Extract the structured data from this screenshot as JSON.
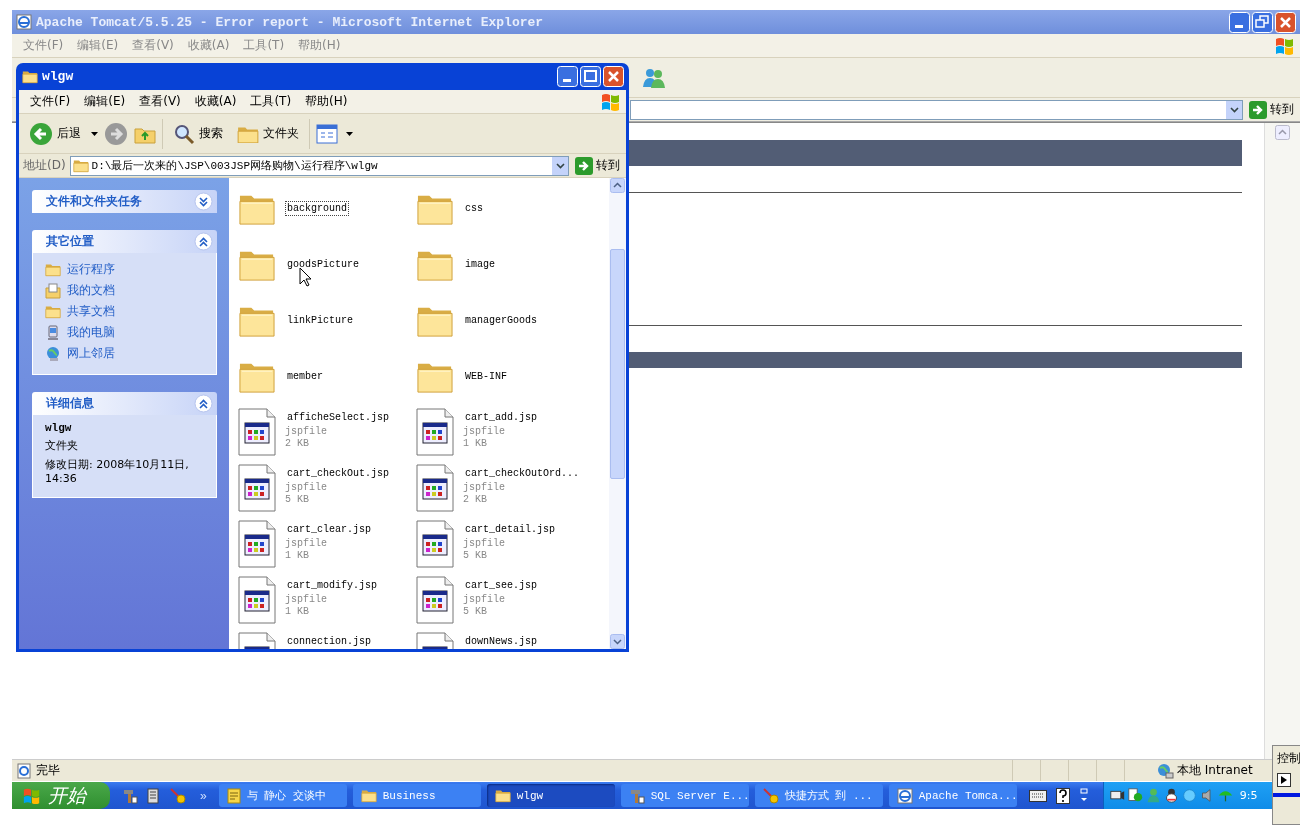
{
  "ie_window": {
    "title": "Apache Tomcat/5.5.25 - Error report - Microsoft Internet Explorer",
    "menu": [
      "文件(F)",
      "编辑(E)",
      "查看(V)",
      "收藏(A)",
      "工具(T)",
      "帮助(H)"
    ],
    "go_button": "转到",
    "status_text": "完毕",
    "zone": "本地 Intranet"
  },
  "explorer": {
    "title": "wlgw",
    "menu": [
      "文件(F)",
      "编辑(E)",
      "查看(V)",
      "收藏(A)",
      "工具(T)",
      "帮助(H)"
    ],
    "toolbar": [
      "后退",
      "搜索",
      "文件夹"
    ],
    "address_label": "地址(D)",
    "address": "D:\\最后一次来的\\JSP\\003JSP网络购物\\运行程序\\wlgw",
    "go_button": "转到",
    "panels": [
      {
        "title": "文件和文件夹任务",
        "expanded": false
      },
      {
        "title": "其它位置",
        "expanded": true,
        "links": [
          {
            "label": "运行程序",
            "kind": "folder"
          },
          {
            "label": "我的文档",
            "kind": "documents"
          },
          {
            "label": "共享文档",
            "kind": "folder"
          },
          {
            "label": "我的电脑",
            "kind": "computer"
          },
          {
            "label": "网上邻居",
            "kind": "network"
          }
        ]
      },
      {
        "title": "详细信息",
        "expanded": true,
        "name": "wlgw",
        "type": "文件夹",
        "modified": "修改日期: 2008年10月11日, 14:36"
      }
    ],
    "items": [
      {
        "kind": "folder",
        "name": "background",
        "selected": true
      },
      {
        "kind": "folder",
        "name": "css",
        "selected": false
      },
      {
        "kind": "folder",
        "name": "goodsPicture",
        "selected": false
      },
      {
        "kind": "folder",
        "name": "image",
        "selected": false
      },
      {
        "kind": "folder",
        "name": "linkPicture",
        "selected": false
      },
      {
        "kind": "folder",
        "name": "managerGoods",
        "selected": false
      },
      {
        "kind": "folder",
        "name": "member",
        "selected": false
      },
      {
        "kind": "folder",
        "name": "WEB-INF",
        "selected": false
      },
      {
        "kind": "file",
        "name": "afficheSelect.jsp",
        "type": "jspfile",
        "size": "2 KB",
        "selected": false
      },
      {
        "kind": "file",
        "name": "cart_add.jsp",
        "type": "jspfile",
        "size": "1 KB",
        "selected": false
      },
      {
        "kind": "file",
        "name": "cart_checkOut.jsp",
        "type": "jspfile",
        "size": "5 KB",
        "selected": false
      },
      {
        "kind": "file",
        "name": "cart_checkOutOrd...",
        "type": "jspfile",
        "size": "2 KB",
        "selected": false
      },
      {
        "kind": "file",
        "name": "cart_clear.jsp",
        "type": "jspfile",
        "size": "1 KB",
        "selected": false
      },
      {
        "kind": "file",
        "name": "cart_detail.jsp",
        "type": "jspfile",
        "size": "5 KB",
        "selected": false
      },
      {
        "kind": "file",
        "name": "cart_modify.jsp",
        "type": "jspfile",
        "size": "1 KB",
        "selected": false
      },
      {
        "kind": "file",
        "name": "cart_see.jsp",
        "type": "jspfile",
        "size": "5 KB",
        "selected": false
      },
      {
        "kind": "file",
        "name": "connection.jsp",
        "selected": false
      },
      {
        "kind": "file",
        "name": "downNews.jsp",
        "selected": false
      }
    ]
  },
  "taskbar": {
    "start": "开始",
    "more": "»",
    "tasks": [
      {
        "label": "与 静心 交谈中",
        "kind": "note",
        "selected": false
      },
      {
        "label": "Business",
        "kind": "folder",
        "selected": false
      },
      {
        "label": "wlgw",
        "kind": "folder",
        "selected": true
      },
      {
        "label": "SQL Server E...",
        "kind": "tool",
        "selected": false
      },
      {
        "label": "快捷方式 到 ...",
        "kind": "wand",
        "selected": false
      },
      {
        "label": "Apache Tomca...",
        "kind": "browser",
        "selected": false
      }
    ],
    "clock": "9:5"
  },
  "side_window": {
    "title": "控制"
  }
}
